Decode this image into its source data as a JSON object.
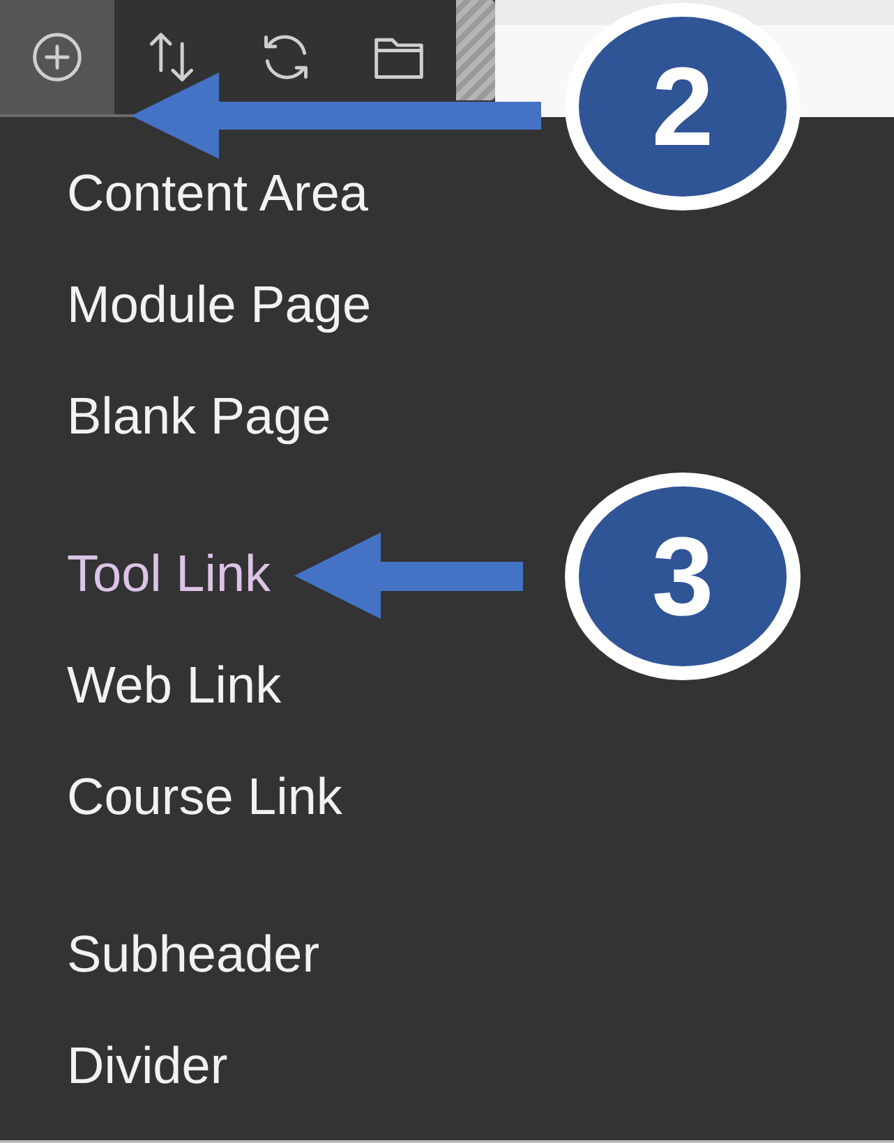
{
  "toolbar": {
    "buttons": [
      {
        "kind": "add",
        "selected": true
      },
      {
        "kind": "reorder",
        "selected": false
      },
      {
        "kind": "refresh",
        "selected": false
      },
      {
        "kind": "folder",
        "selected": false
      }
    ]
  },
  "menu": {
    "groups": [
      {
        "items": [
          {
            "label": "Content Area",
            "highlighted": false
          },
          {
            "label": "Module Page",
            "highlighted": false
          },
          {
            "label": "Blank Page",
            "highlighted": false
          }
        ]
      },
      {
        "items": [
          {
            "label": "Tool Link",
            "highlighted": true
          },
          {
            "label": "Web Link",
            "highlighted": false
          },
          {
            "label": "Course Link",
            "highlighted": false
          }
        ]
      },
      {
        "items": [
          {
            "label": "Subheader",
            "highlighted": false
          },
          {
            "label": "Divider",
            "highlighted": false
          }
        ]
      }
    ]
  },
  "callouts": [
    {
      "number": "2"
    },
    {
      "number": "3"
    }
  ]
}
